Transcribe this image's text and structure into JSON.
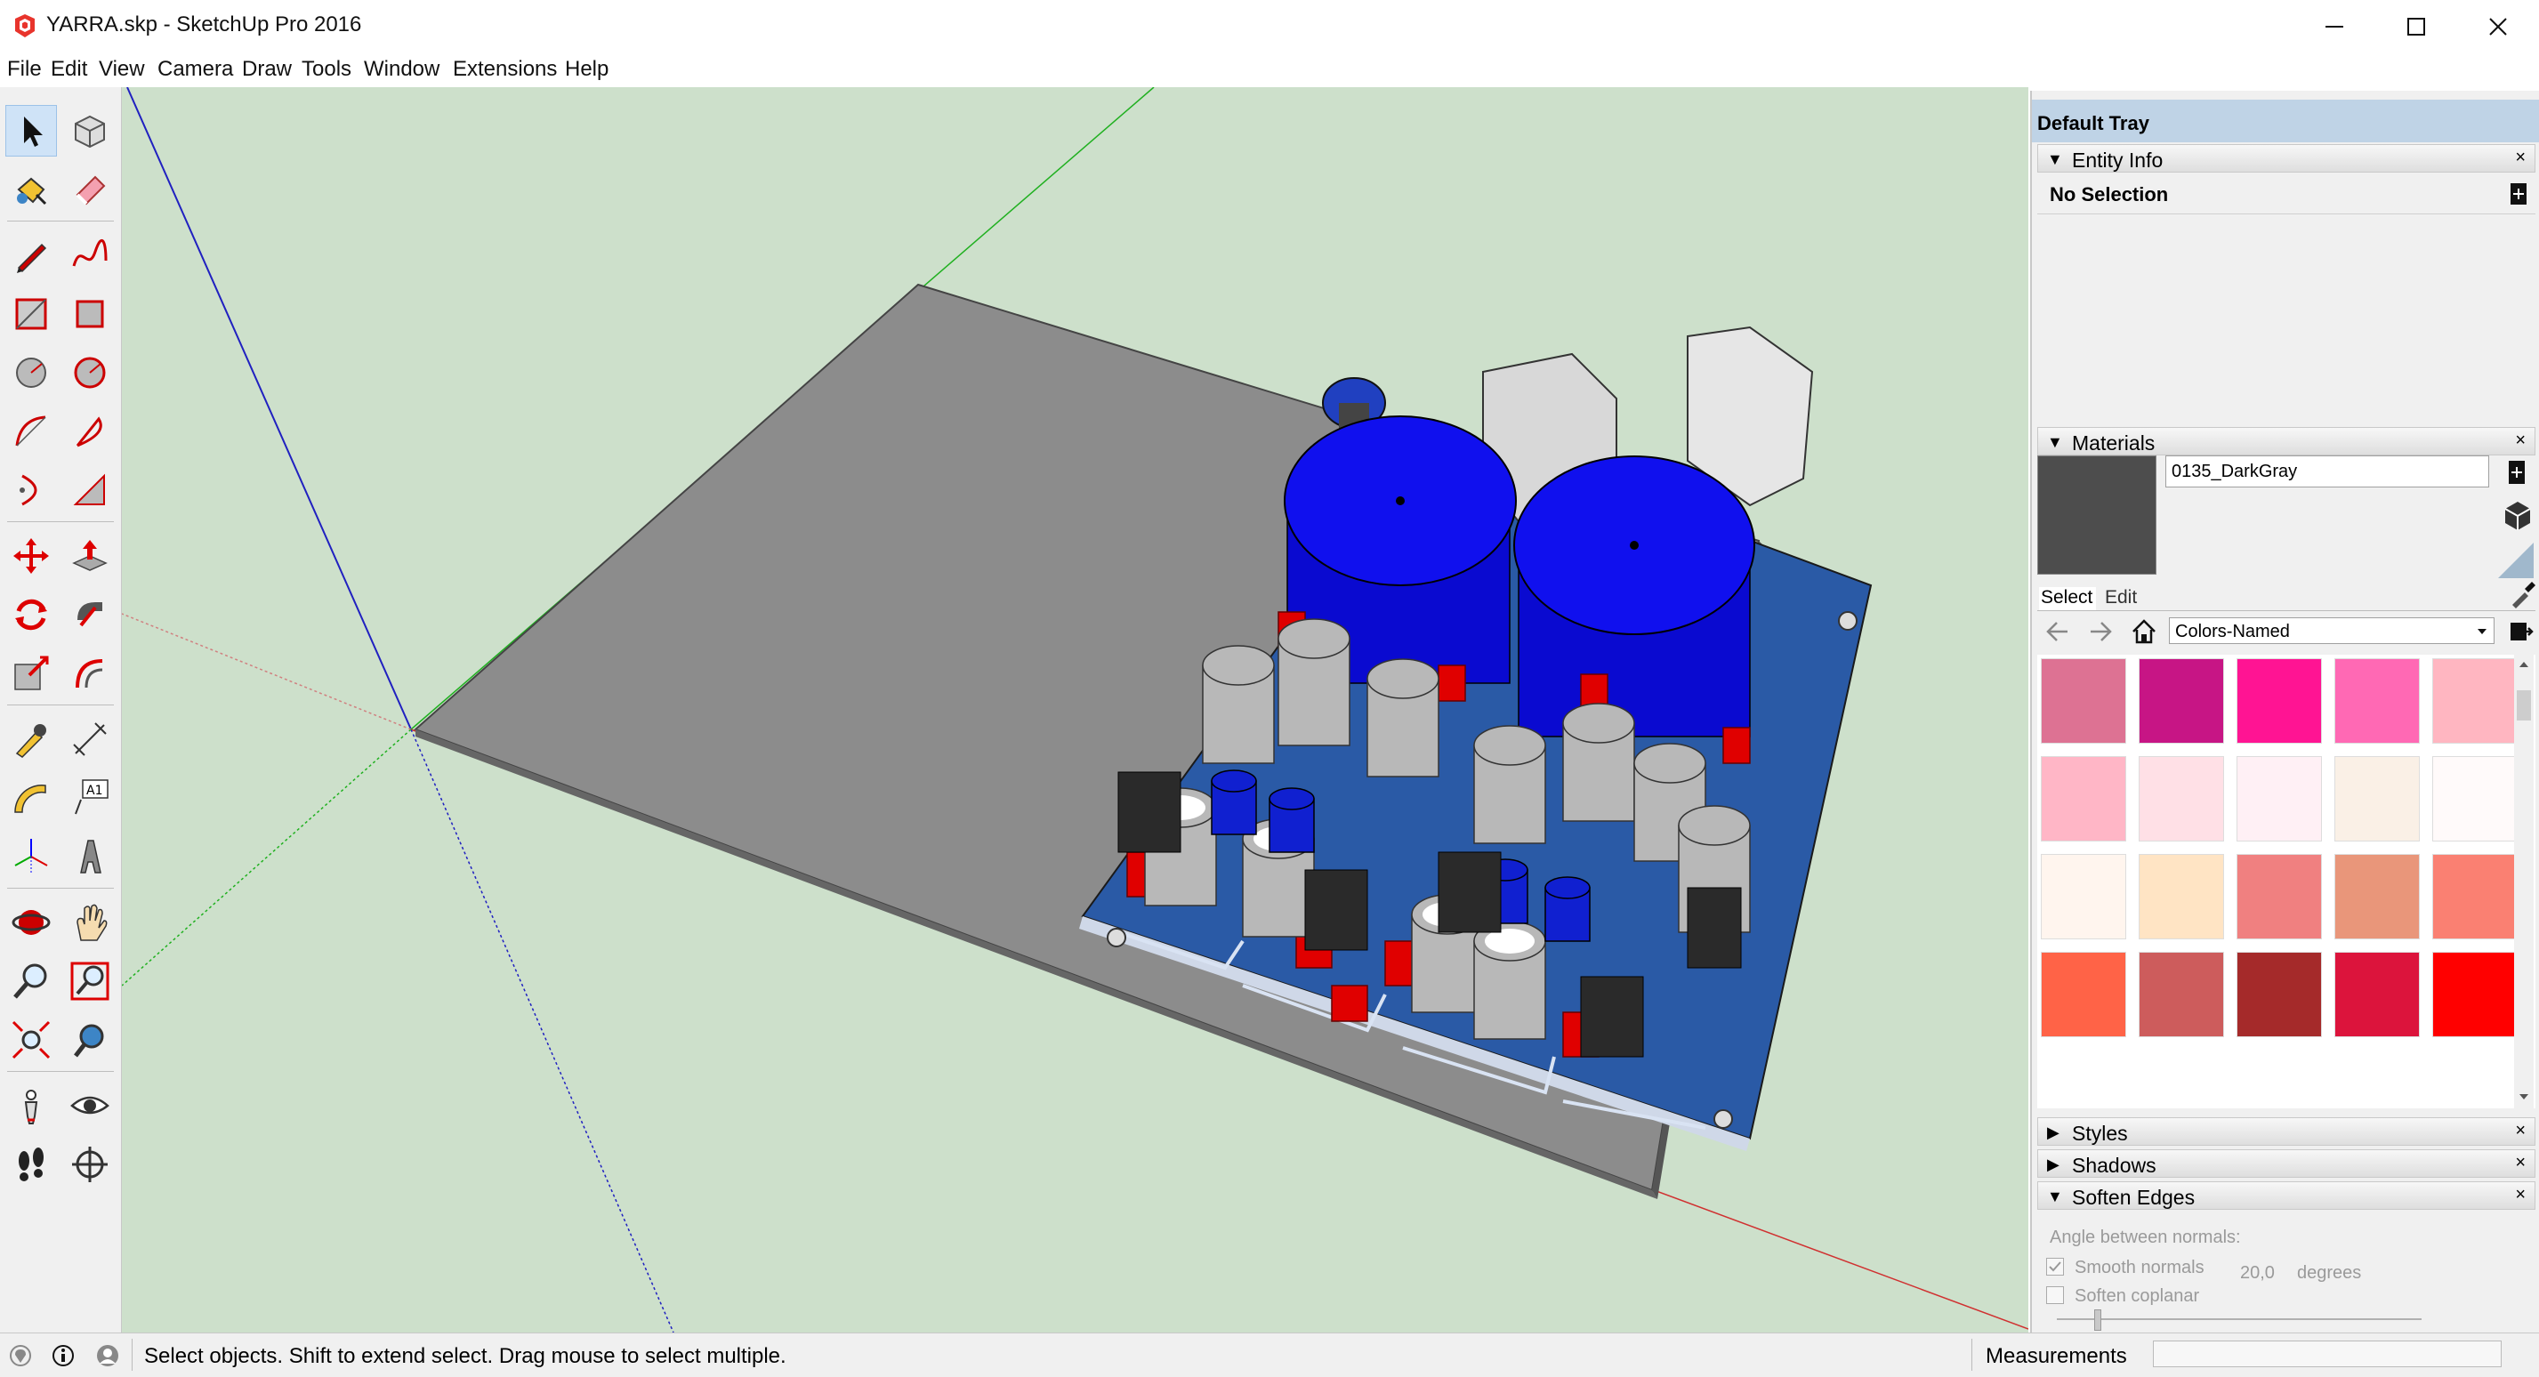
{
  "window": {
    "title": "YARRA.skp - SketchUp Pro 2016",
    "controls": {
      "minimize": "—",
      "maximize": "☐",
      "close": "✕"
    }
  },
  "menu": [
    "File",
    "Edit",
    "View",
    "Camera",
    "Draw",
    "Tools",
    "Window",
    "Extensions",
    "Help"
  ],
  "toolbar": {
    "tools": [
      "select",
      "make-component",
      "paint-bucket",
      "eraser",
      "line",
      "freehand",
      "rectangle",
      "rotated-rectangle",
      "circle",
      "polygon",
      "arc",
      "pie",
      "two-point-arc",
      "three-point-arc",
      "move",
      "push-pull",
      "rotate",
      "follow-me",
      "scale",
      "offset",
      "tape-measure",
      "dimension",
      "protractor",
      "text",
      "axes",
      "3d-text",
      "orbit",
      "pan",
      "zoom",
      "zoom-window",
      "zoom-extents",
      "previous-view",
      "position-camera",
      "look-around",
      "walk",
      "section-plane"
    ],
    "text_tool_label": "A1"
  },
  "tray": {
    "title": "Default Tray",
    "entity_info": {
      "title": "Entity Info",
      "selection": "No Selection"
    },
    "materials": {
      "title": "Materials",
      "name": "0135_DarkGray",
      "preview_color": "#4d4d4d",
      "tabs": [
        "Select",
        "Edit"
      ],
      "library": "Colors-Named",
      "swatches": [
        "#dd7293",
        "#c71585",
        "#ff1493",
        "#ff69b4",
        "#ffb6c1",
        "#ffb6c6",
        "#ffe0e6",
        "#fff0f5",
        "#faf0e6",
        "#fffafa",
        "#fff5ee",
        "#ffe4c4",
        "#f08080",
        "#e9967a",
        "#fa8072",
        "#ff6347",
        "#cd5c5c",
        "#a52a2a",
        "#dc143c",
        "#ff0000"
      ]
    },
    "collapsed_panels": [
      "Styles",
      "Shadows"
    ],
    "soften_edges": {
      "title": "Soften Edges",
      "angle_label": "Angle between normals:",
      "angle_value": "20,0",
      "angle_unit": "degrees",
      "smooth_normals": "Smooth normals",
      "soften_coplanar": "Soften coplanar",
      "smooth_checked": true,
      "coplanar_checked": false
    }
  },
  "status": {
    "message": "Select objects. Shift to extend select. Drag mouse to select multiple.",
    "measurements_label": "Measurements"
  },
  "colors": {
    "viewport_bg": "#cde0cb",
    "tray_title_bg": "#bfd3e6",
    "active_tool_bg": "#cfe3f7"
  }
}
